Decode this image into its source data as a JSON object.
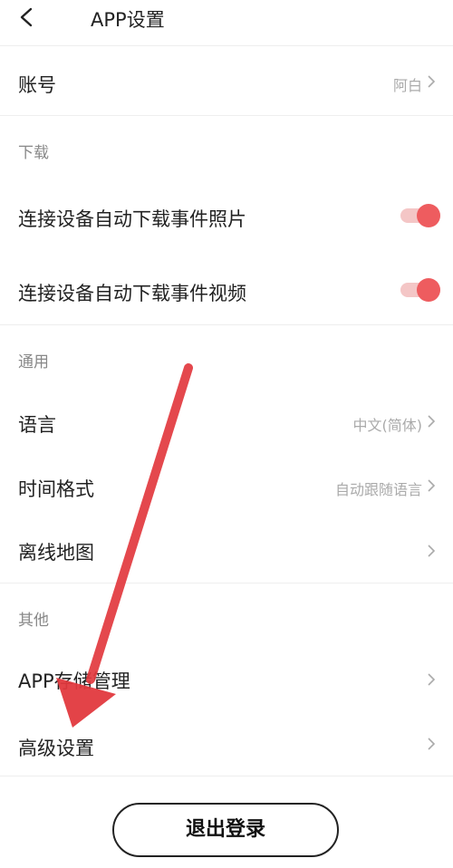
{
  "header": {
    "title": "APP设置"
  },
  "account": {
    "label": "账号",
    "value": "阿白"
  },
  "download": {
    "section": "下载",
    "photo_label": "连接设备自动下载事件照片",
    "video_label": "连接设备自动下载事件视频",
    "photo_on": true,
    "video_on": true
  },
  "general": {
    "section": "通用",
    "language_label": "语言",
    "language_value": "中文(简体)",
    "timeformat_label": "时间格式",
    "timeformat_value": "自动跟随语言",
    "offlinemap_label": "离线地图"
  },
  "other": {
    "section": "其他",
    "storage_label": "APP存储管理",
    "advanced_label": "高级设置"
  },
  "logout": {
    "label": "退出登录"
  },
  "colors": {
    "accent": "#ee5c5f",
    "arrow": "#e2393e"
  }
}
